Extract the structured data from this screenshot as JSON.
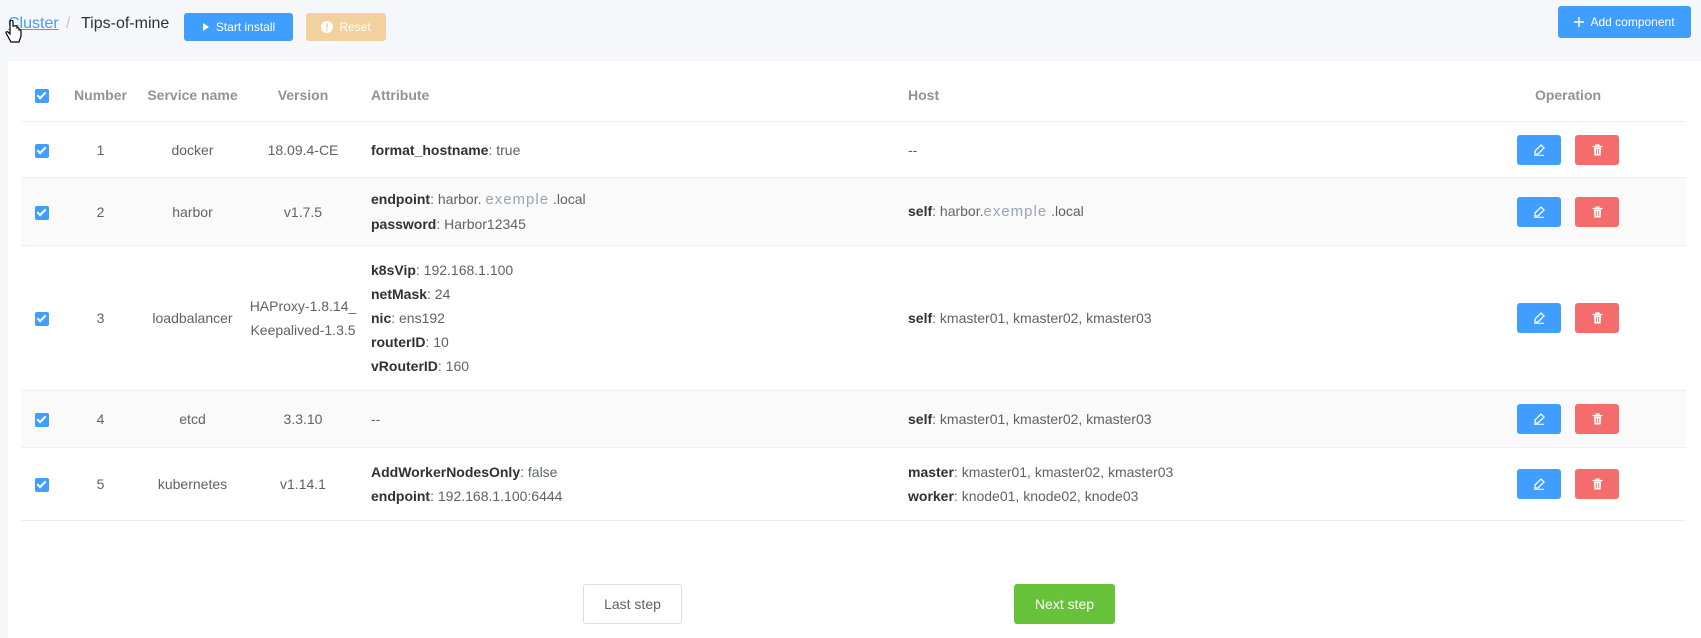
{
  "breadcrumb": {
    "root": "Cluster",
    "separator": "/",
    "current": "Tips-of-mine"
  },
  "toolbar": {
    "start_install": "Start install",
    "reset": "Reset",
    "add_component": "Add component"
  },
  "table": {
    "headers": {
      "number": "Number",
      "service": "Service name",
      "version": "Version",
      "attribute": "Attribute",
      "host": "Host",
      "operation": "Operation"
    },
    "rows": [
      {
        "number": "1",
        "service": "docker",
        "version": "18.09.4-CE",
        "attributes": [
          {
            "key": "format_hostname",
            "value": ": true"
          }
        ],
        "host_text": "--"
      },
      {
        "number": "2",
        "service": "harbor",
        "version": "v1.7.5",
        "attributes": [
          {
            "key": "endpoint",
            "value_pre": ": harbor.",
            "value_em": "exemple",
            "value_post": ".local"
          },
          {
            "key": "password",
            "value": ": Harbor12345"
          }
        ],
        "hosts": [
          {
            "key": "self",
            "value_pre": ": harbor.",
            "value_em": "exemple",
            "value_post": ".local"
          }
        ]
      },
      {
        "number": "3",
        "service": "loadbalancer",
        "version": "HAProxy-1.8.14_Keepalived-1.3.5",
        "attributes": [
          {
            "key": "k8sVip",
            "value": ": 192.168.1.100"
          },
          {
            "key": "netMask",
            "value": ": 24"
          },
          {
            "key": "nic",
            "value": ": ens192"
          },
          {
            "key": "routerID",
            "value": ": 10"
          },
          {
            "key": "vRouterID",
            "value": ": 160"
          }
        ],
        "hosts": [
          {
            "key": "self",
            "value": ": kmaster01, kmaster02, kmaster03"
          }
        ]
      },
      {
        "number": "4",
        "service": "etcd",
        "version": "3.3.10",
        "attribute_text": "--",
        "hosts": [
          {
            "key": "self",
            "value": ": kmaster01, kmaster02, kmaster03"
          }
        ]
      },
      {
        "number": "5",
        "service": "kubernetes",
        "version": "v1.14.1",
        "attributes": [
          {
            "key": "AddWorkerNodesOnly",
            "value": ": false"
          },
          {
            "key": "endpoint",
            "value": ": 192.168.1.100:6444"
          }
        ],
        "hosts": [
          {
            "key": "master",
            "value": ": kmaster01, kmaster02, kmaster03"
          },
          {
            "key": "worker",
            "value": ": knode01, knode02, knode03"
          }
        ]
      }
    ]
  },
  "footer": {
    "last_step": "Last step",
    "next_step": "Next step"
  },
  "colors": {
    "primary": "#409eff",
    "danger": "#f56c6c",
    "success": "#67c23a",
    "warning_light": "#f3d19e"
  }
}
